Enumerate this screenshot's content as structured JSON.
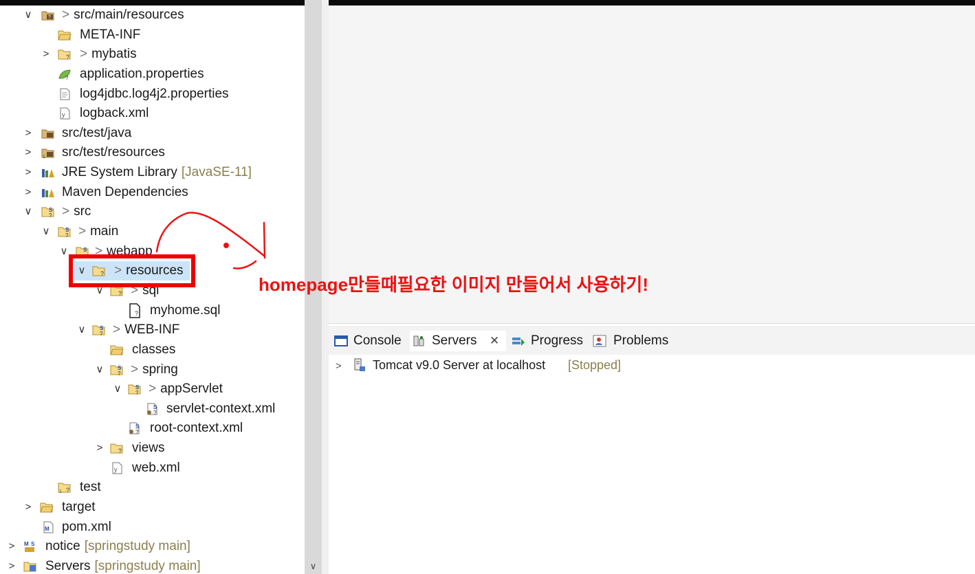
{
  "explorer": {
    "items": [
      {
        "twisty": "∨",
        "icon": "source-folder-icon",
        "prefix": ">",
        "label": "src/main/resources",
        "dec": ""
      },
      {
        "twisty": "",
        "icon": "folder-icon",
        "prefix": "",
        "label": "META-INF",
        "dec": ""
      },
      {
        "twisty": ">",
        "icon": "folder-question-icon",
        "prefix": ">",
        "label": "mybatis",
        "dec": ""
      },
      {
        "twisty": "",
        "icon": "properties-leaf-icon",
        "prefix": "",
        "label": "application.properties",
        "dec": ""
      },
      {
        "twisty": "",
        "icon": "text-file-icon",
        "prefix": "",
        "label": "log4jdbc.log4j2.properties",
        "dec": ""
      },
      {
        "twisty": "",
        "icon": "xml-file-icon",
        "prefix": "",
        "label": "logback.xml",
        "dec": ""
      },
      {
        "twisty": ">",
        "icon": "source-folder-icon",
        "prefix": "",
        "label": "src/test/java",
        "dec": ""
      },
      {
        "twisty": ">",
        "icon": "source-folder-icon",
        "prefix": "",
        "label": "src/test/resources",
        "dec": ""
      },
      {
        "twisty": ">",
        "icon": "library-icon",
        "prefix": "",
        "label": "JRE System Library",
        "dec": "[JavaSE-11]"
      },
      {
        "twisty": ">",
        "icon": "library-icon",
        "prefix": "",
        "label": "Maven Dependencies",
        "dec": ""
      },
      {
        "twisty": "∨",
        "icon": "folder-s-icon",
        "prefix": ">",
        "label": "src",
        "dec": ""
      },
      {
        "twisty": "∨",
        "icon": "folder-s-icon",
        "prefix": ">",
        "label": "main",
        "dec": ""
      },
      {
        "twisty": "∨",
        "icon": "folder-s-icon",
        "prefix": ">",
        "label": "webapp",
        "dec": ""
      },
      {
        "twisty": "∨",
        "icon": "folder-question-icon",
        "prefix": ">",
        "label": "resources",
        "dec": ""
      },
      {
        "twisty": "∨",
        "icon": "folder-question-icon",
        "prefix": ">",
        "label": "sql",
        "dec": ""
      },
      {
        "twisty": "",
        "icon": "sql-file-icon",
        "prefix": "",
        "label": "myhome.sql",
        "dec": ""
      },
      {
        "twisty": "∨",
        "icon": "folder-s-icon",
        "prefix": ">",
        "label": "WEB-INF",
        "dec": ""
      },
      {
        "twisty": "",
        "icon": "folder-icon",
        "prefix": "",
        "label": "classes",
        "dec": ""
      },
      {
        "twisty": "∨",
        "icon": "folder-s-icon",
        "prefix": ">",
        "label": "spring",
        "dec": ""
      },
      {
        "twisty": "∨",
        "icon": "folder-s-icon",
        "prefix": ">",
        "label": "appServlet",
        "dec": ""
      },
      {
        "twisty": "",
        "icon": "spring-xml-icon",
        "prefix": "",
        "label": "servlet-context.xml",
        "dec": ""
      },
      {
        "twisty": "",
        "icon": "spring-xml-icon",
        "prefix": "",
        "label": "root-context.xml",
        "dec": ""
      },
      {
        "twisty": ">",
        "icon": "folder-question-icon",
        "prefix": "",
        "label": "views",
        "dec": ""
      },
      {
        "twisty": "",
        "icon": "xml-file-icon",
        "prefix": "",
        "label": "web.xml",
        "dec": ""
      },
      {
        "twisty": "",
        "icon": "package-question-icon",
        "prefix": "",
        "label": "test",
        "dec": ""
      },
      {
        "twisty": ">",
        "icon": "folder-icon",
        "prefix": "",
        "label": "target",
        "dec": ""
      },
      {
        "twisty": "",
        "icon": "maven-pom-icon",
        "prefix": "",
        "label": "pom.xml",
        "dec": ""
      },
      {
        "twisty": ">",
        "icon": "maven-project-icon",
        "prefix": "",
        "label": "notice",
        "dec": "[springstudy main]"
      },
      {
        "twisty": ">",
        "icon": "servers-project-icon",
        "prefix": "",
        "label": "Servers",
        "dec": "[springstudy main]"
      }
    ]
  },
  "views": {
    "tabs": [
      {
        "label": "Console",
        "icon": "console-icon",
        "close": ""
      },
      {
        "label": "Servers",
        "icon": "servers-icon",
        "close": "✕"
      },
      {
        "label": "Progress",
        "icon": "progress-icon",
        "close": ""
      },
      {
        "label": "Problems",
        "icon": "problems-icon",
        "close": ""
      }
    ],
    "server": {
      "twisty": ">",
      "label": "Tomcat v9.0 Server at localhost",
      "status": "[Stopped]"
    }
  },
  "scrollbar": {
    "down_arrow": "∨"
  },
  "annotation": {
    "text": "homepage만들때필요한 이미지 만들어서 사용하기!",
    "color": "#ee1111"
  }
}
